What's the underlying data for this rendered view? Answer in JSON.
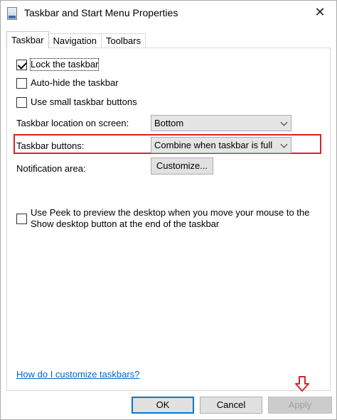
{
  "window": {
    "title": "Taskbar and Start Menu Properties",
    "close_glyph": "✕"
  },
  "tabs": [
    {
      "label": "Taskbar",
      "active": true
    },
    {
      "label": "Navigation",
      "active": false
    },
    {
      "label": "Toolbars",
      "active": false
    }
  ],
  "checkboxes": {
    "lock": {
      "label": "Lock the taskbar",
      "checked": true
    },
    "autohide": {
      "label": "Auto-hide the taskbar",
      "checked": false
    },
    "small": {
      "label": "Use small taskbar buttons",
      "checked": false
    },
    "peek": {
      "label": "Use Peek to preview the desktop when you move your mouse to the Show desktop button at the end of the taskbar",
      "checked": false
    }
  },
  "location": {
    "label": "Taskbar location on screen:",
    "value": "Bottom"
  },
  "buttons_setting": {
    "label": "Taskbar buttons:",
    "value": "Combine when taskbar is full"
  },
  "notification": {
    "label": "Notification area:",
    "button": "Customize..."
  },
  "help_link": "How do I customize taskbars?",
  "footer": {
    "ok": "OK",
    "cancel": "Cancel",
    "apply": "Apply"
  },
  "colors": {
    "highlight": "#d9232e",
    "link": "#0066cc",
    "focus": "#0078d7"
  }
}
